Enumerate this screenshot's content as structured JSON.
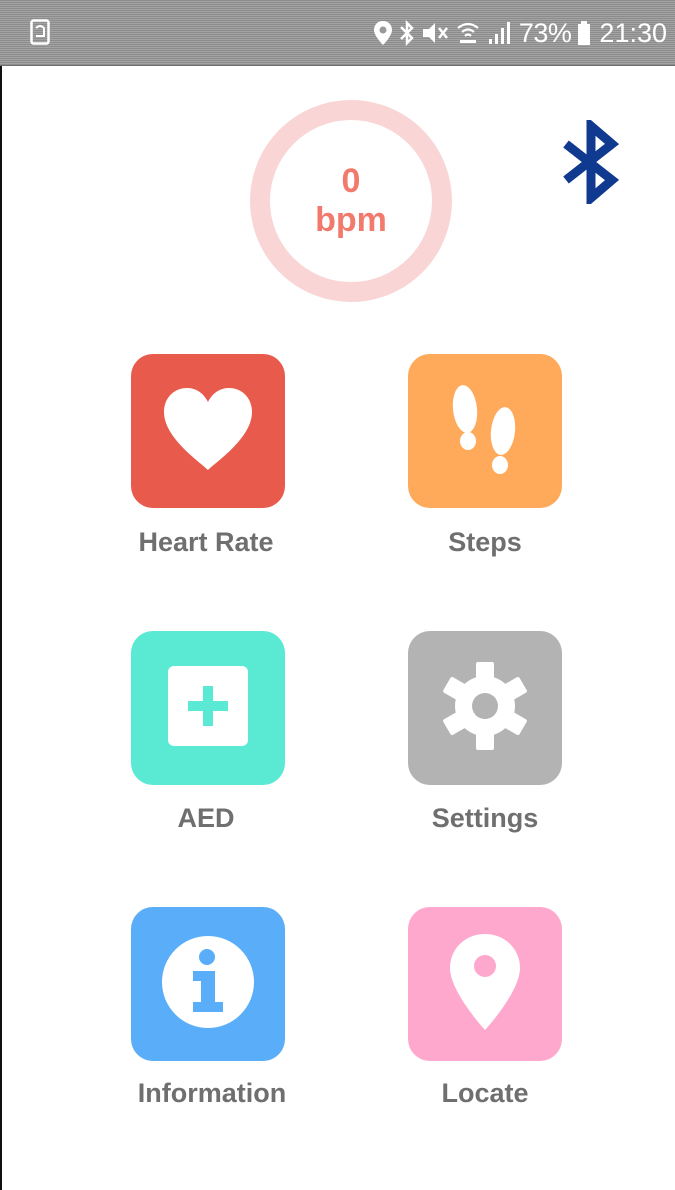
{
  "status_bar": {
    "left_icon": "screen-rotate-icon",
    "icons": [
      "location-icon",
      "bluetooth-icon",
      "mute-icon",
      "wifi-calling-icon",
      "signal-icon"
    ],
    "battery_percent": "73%",
    "time": "21:30"
  },
  "heart_monitor": {
    "value": "0",
    "unit": "bpm",
    "color": "#f27a6c",
    "ring_color": "#f9d5d5"
  },
  "bluetooth": {
    "icon": "bluetooth-icon",
    "color": "#0f3a8f"
  },
  "tiles": [
    {
      "label": "Heart Rate",
      "icon": "heart-icon",
      "color": "#e85b4c"
    },
    {
      "label": "Steps",
      "icon": "footsteps-icon",
      "color": "#ffa95a"
    },
    {
      "label": "AED",
      "icon": "aed-plus-icon",
      "color": "#5aead4"
    },
    {
      "label": "Settings",
      "icon": "gear-icon",
      "color": "#b3b3b3"
    },
    {
      "label": "Information",
      "icon": "info-icon",
      "color": "#5aaef9"
    },
    {
      "label": "Locate",
      "icon": "location-pin-icon",
      "color": "#ffa8cd"
    }
  ]
}
